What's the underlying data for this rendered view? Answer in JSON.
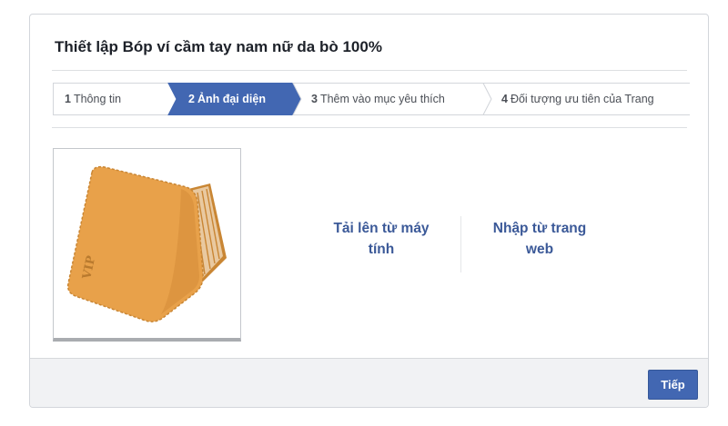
{
  "dialog": {
    "title": "Thiết lập Bóp ví cầm tay nam nữ da bò 100%"
  },
  "steps": [
    {
      "number": "1",
      "label": "Thông tin",
      "active": false
    },
    {
      "number": "2",
      "label": "Ảnh đại diện",
      "active": true
    },
    {
      "number": "3",
      "label": "Thêm vào mục yêu thích",
      "active": false
    },
    {
      "number": "4",
      "label": "Đối tượng ưu tiên của Trang",
      "active": false
    }
  ],
  "photo": {
    "brand_mark": "VIP"
  },
  "options": {
    "upload": {
      "line1": "Tải lên từ máy",
      "line2": "tính"
    },
    "import": {
      "line1": "Nhập từ trang",
      "line2": "web"
    }
  },
  "footer": {
    "next_label": "Tiếp"
  },
  "colors": {
    "accent": "#4267b2",
    "link": "#3b5998",
    "active_step": "#4267b2",
    "wallet": "#e8a14a"
  }
}
